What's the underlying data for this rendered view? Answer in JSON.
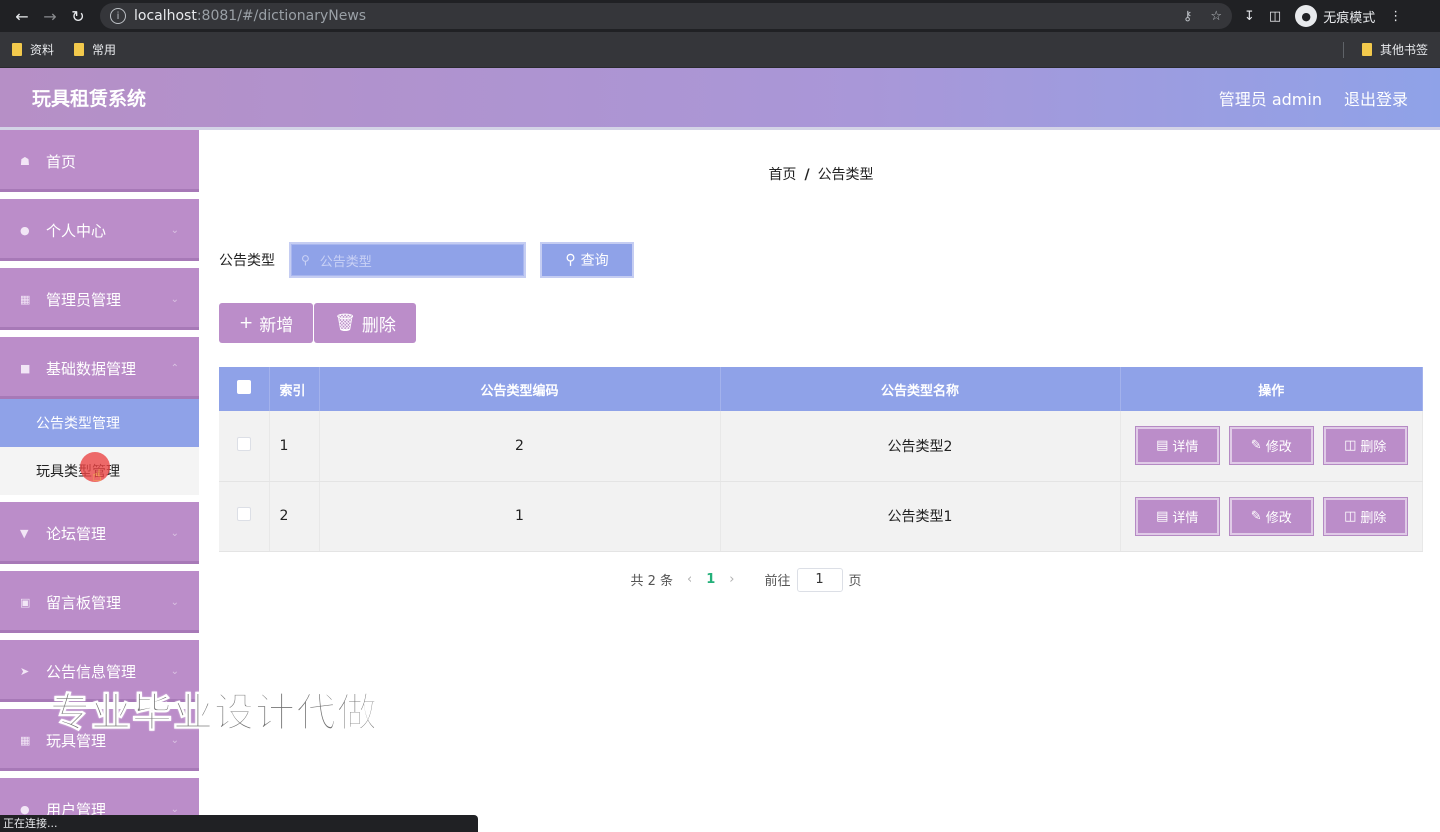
{
  "browser": {
    "url_host": "localhost",
    "url_rest": ":8081/#/dictionaryNews",
    "incognito_label": "无痕模式",
    "bookmarks": [
      "资料",
      "常用"
    ],
    "other_bookmarks": "其他书签",
    "status_text": "正在连接..."
  },
  "header": {
    "title": "玩具租赁系统",
    "user_label": "管理员 admin",
    "logout_label": "退出登录"
  },
  "sidebar": {
    "items": [
      {
        "label": "首页",
        "icon": "home-icon"
      },
      {
        "label": "个人中心",
        "icon": "user-icon"
      },
      {
        "label": "管理员管理",
        "icon": "grid-icon"
      },
      {
        "label": "基础数据管理",
        "icon": "chat-icon"
      },
      {
        "label": "论坛管理",
        "icon": "cup-icon"
      },
      {
        "label": "留言板管理",
        "icon": "clipboard-icon"
      },
      {
        "label": "公告信息管理",
        "icon": "send-icon"
      },
      {
        "label": "玩具管理",
        "icon": "grid-icon"
      },
      {
        "label": "用户管理",
        "icon": "user-icon"
      }
    ],
    "submenu": [
      "公告类型管理",
      "玩具类型管理"
    ]
  },
  "breadcrumb": {
    "home": "首页",
    "sep": "/",
    "current": "公告类型"
  },
  "search": {
    "label": "公告类型",
    "placeholder": "公告类型",
    "button": "查询"
  },
  "actions": {
    "add": "新增",
    "delete": "删除"
  },
  "table": {
    "headers": [
      "索引",
      "公告类型编码",
      "公告类型名称",
      "操作"
    ],
    "rows": [
      {
        "index": "1",
        "code": "2",
        "name": "公告类型2"
      },
      {
        "index": "2",
        "code": "1",
        "name": "公告类型1"
      }
    ],
    "ops": {
      "detail": "详情",
      "edit": "修改",
      "delete": "删除"
    }
  },
  "pagination": {
    "total": "共 2 条",
    "current_page": "1",
    "goto_prefix": "前往",
    "goto_value": "1",
    "goto_suffix": "页"
  },
  "watermark": "专业毕业设计代做",
  "colors": {
    "header_gradient_start": "#b68fc6",
    "header_gradient_end": "#8fa2e8",
    "menu": "#bb8dc9",
    "accent": "#8fa2e8"
  }
}
